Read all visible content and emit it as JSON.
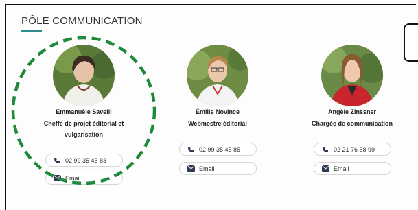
{
  "section": {
    "title": "PÔLE COMMUNICATION"
  },
  "people": [
    {
      "name": "Emmanuèle Savelli",
      "role_line1": "Cheffe de projet éditorial et",
      "role_line2": "vulgarisation",
      "phone": "02 99 35 45 83",
      "email_label": "Email"
    },
    {
      "name": "Émilie Novince",
      "role_line1": "Webmestre éditorial",
      "role_line2": "",
      "phone": "02 99 35 45 85",
      "email_label": "Email"
    },
    {
      "name": "Angèle Zinssner",
      "role_line1": "Chargée de communication",
      "role_line2": "",
      "phone": "02 21 76 58 99",
      "email_label": "Email"
    }
  ],
  "colors": {
    "accent": "#2e8b8b",
    "highlight_circle": "#1e8a3a"
  }
}
